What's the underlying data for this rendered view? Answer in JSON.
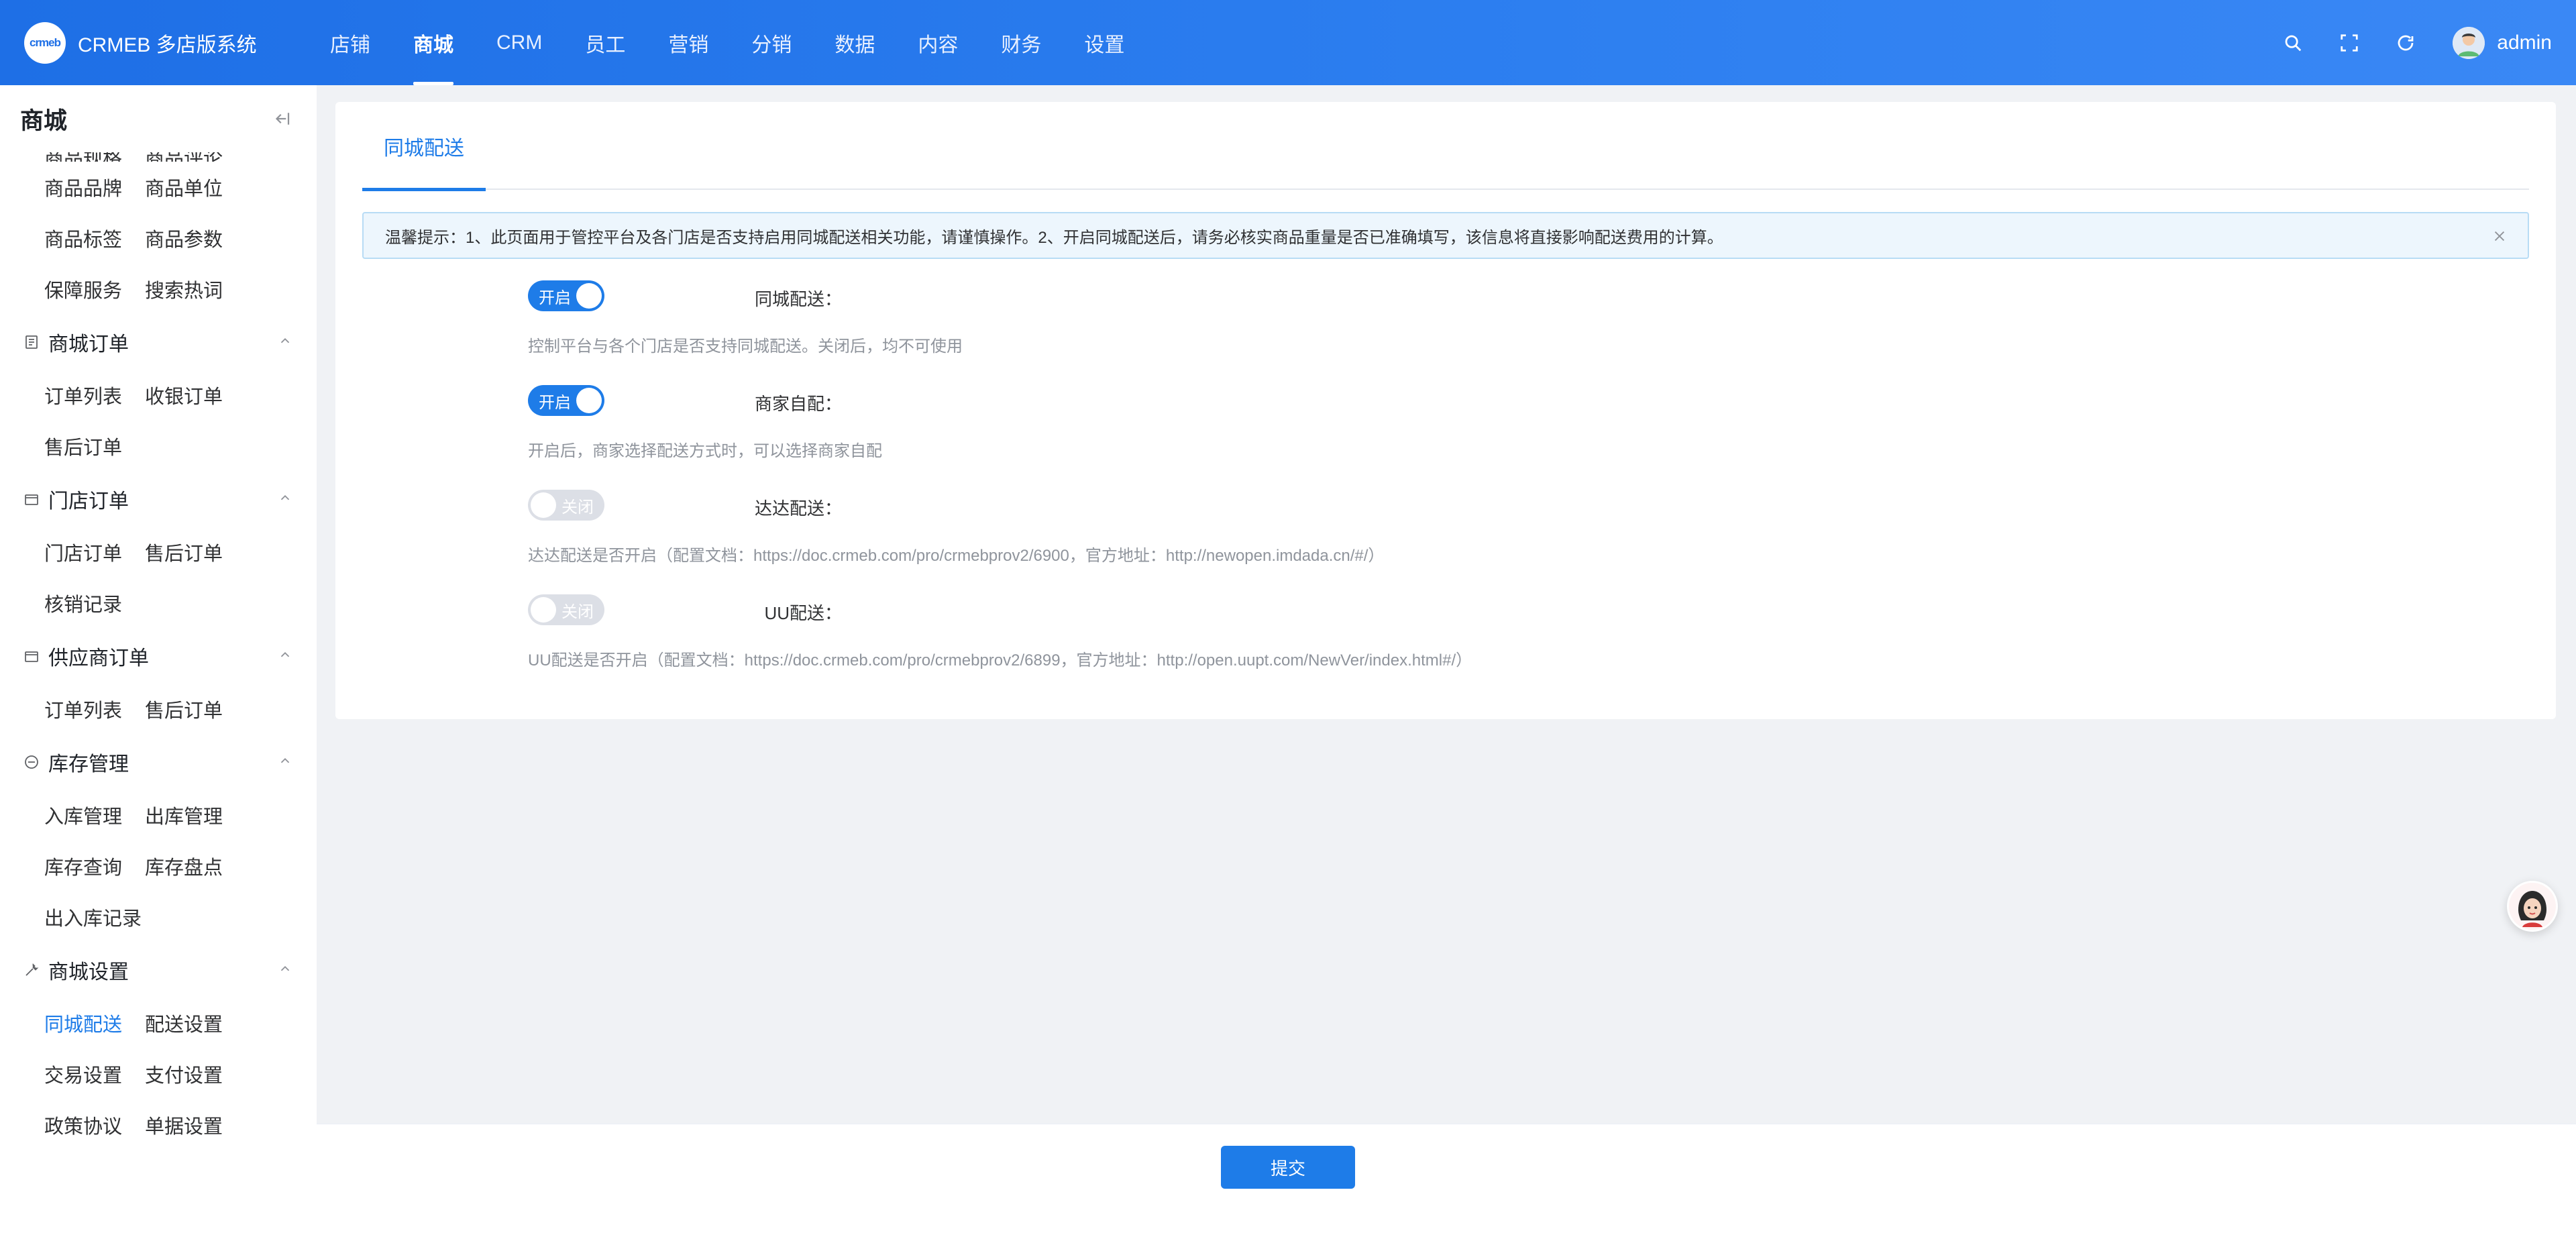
{
  "header": {
    "logo_badge": "crmeb",
    "logo_text": "CRMEB 多店版系统",
    "nav": [
      "店铺",
      "商城",
      "CRM",
      "员工",
      "营销",
      "分销",
      "数据",
      "内容",
      "财务",
      "设置"
    ],
    "active_nav": "商城",
    "username": "admin",
    "brand_color": "#1e6fe6"
  },
  "sidebar": {
    "title": "商城",
    "top_partial": [
      "商品规格",
      "商品评论"
    ],
    "rows_top": [
      [
        "商品品牌",
        "商品单位"
      ],
      [
        "商品标签",
        "商品参数"
      ],
      [
        "保障服务",
        "搜索热词"
      ]
    ],
    "groups": [
      {
        "label": "商城订单",
        "icon": "list-icon",
        "rows": [
          [
            "订单列表",
            "收银订单"
          ],
          [
            "售后订单",
            ""
          ]
        ]
      },
      {
        "label": "门店订单",
        "icon": "store-icon",
        "rows": [
          [
            "门店订单",
            "售后订单"
          ],
          [
            "核销记录",
            ""
          ]
        ]
      },
      {
        "label": "供应商订单",
        "icon": "supplier-icon",
        "rows": [
          [
            "订单列表",
            "售后订单"
          ]
        ]
      },
      {
        "label": "库存管理",
        "icon": "stock-icon",
        "rows": [
          [
            "入库管理",
            "出库管理"
          ],
          [
            "库存查询",
            "库存盘点"
          ],
          [
            "出入库记录",
            ""
          ]
        ]
      },
      {
        "label": "商城设置",
        "icon": "wrench-icon",
        "rows": [
          [
            "同城配送",
            "配送设置"
          ],
          [
            "交易设置",
            "支付设置"
          ],
          [
            "政策协议",
            "单据设置"
          ]
        ]
      }
    ],
    "active_item": "同城配送"
  },
  "main": {
    "tab": "同城配送",
    "alert": "温馨提示：1、此页面用于管控平台及各门店是否支持启用同城配送相关功能，请谨慎操作。2、开启同城配送后，请务必核实商品重量是否已准确填写，该信息将直接影响配送费用的计算。",
    "fields": [
      {
        "label": "同城配送：",
        "state": "on",
        "switch_text": "开启",
        "tip": "控制平台与各个门店是否支持同城配送。关闭后，均不可使用"
      },
      {
        "label": "商家自配：",
        "state": "on",
        "switch_text": "开启",
        "tip": "开启后，商家选择配送方式时，可以选择商家自配"
      },
      {
        "label": "达达配送：",
        "state": "off",
        "switch_text": "关闭",
        "tip": "达达配送是否开启（配置文档：https://doc.crmeb.com/pro/crmebprov2/6900，官方地址：http://newopen.imdada.cn/#/）"
      },
      {
        "label": "UU配送：",
        "state": "off",
        "switch_text": "关闭",
        "tip": "UU配送是否开启（配置文档：https://doc.crmeb.com/pro/crmebprov2/6899，官方地址：http://open.uupt.com/NewVer/index.html#/）"
      }
    ],
    "submit": "提交"
  }
}
